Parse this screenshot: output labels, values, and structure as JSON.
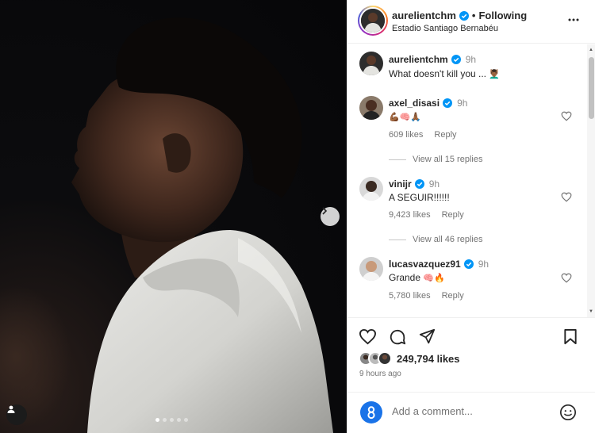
{
  "post": {
    "author": "aurelientchm",
    "follow_sep": "•",
    "follow_status": "Following",
    "location": "Estadio Santiago Bernabéu",
    "likes": "249,794 likes",
    "time_ago": "9 hours ago",
    "carousel_count": 5,
    "carousel_active": 1
  },
  "comments": [
    {
      "user": "aurelientchm",
      "time": "9h",
      "text": "What doesn't kill you ... ",
      "emoji": "💆🏾‍♂️",
      "likes": "",
      "reply": "",
      "replies": ""
    },
    {
      "user": "axel_disasi",
      "time": "9h",
      "text": "",
      "emoji": "💪🏾🧠🙏🏾",
      "likes": "609 likes",
      "reply": "Reply",
      "replies": "View all 15 replies"
    },
    {
      "user": "vinijr",
      "time": "9h",
      "text": "A SEGUIR!!!!!!",
      "emoji": "",
      "likes": "9,423 likes",
      "reply": "Reply",
      "replies": "View all 46 replies"
    },
    {
      "user": "lucasvazquez91",
      "time": "9h",
      "text": "Grande ",
      "emoji": "🧠🔥",
      "likes": "5,780 likes",
      "reply": "Reply",
      "replies": ""
    }
  ],
  "add_comment": {
    "placeholder": "Add a comment..."
  },
  "icons": [
    "verified-badge-icon",
    "more-options-icon",
    "heart-icon",
    "comment-icon",
    "share-icon",
    "bookmark-icon",
    "emoji-icon",
    "chevron-right-icon",
    "user-tag-icon"
  ],
  "colors": {
    "verified": "#0095f6",
    "text": "#262626",
    "muted": "#737373",
    "brand_logo": "#1a73e8"
  }
}
